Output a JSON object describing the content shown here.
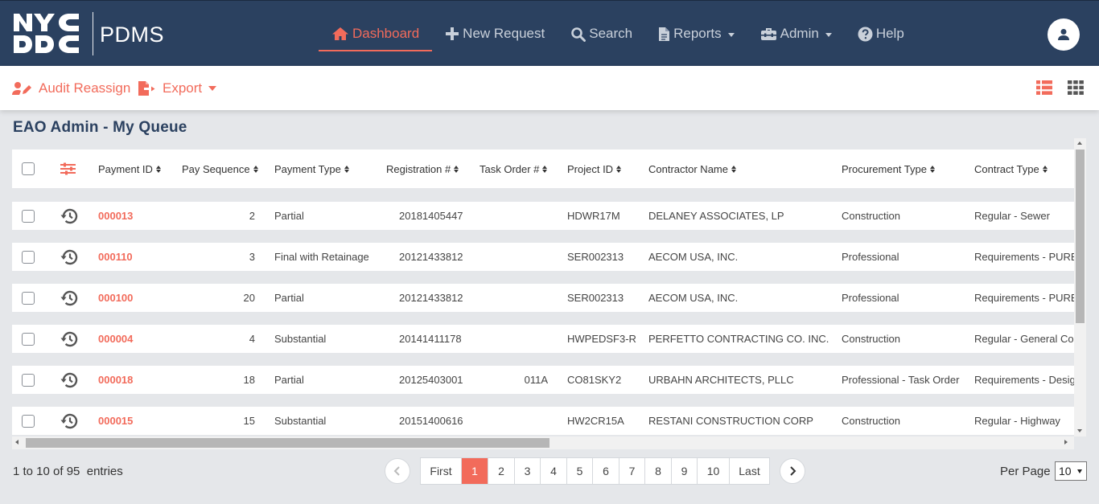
{
  "app": {
    "logo_text": "NYC DDC",
    "name": "PDMS"
  },
  "nav": [
    {
      "label": "Dashboard",
      "icon": "home-icon",
      "active": true
    },
    {
      "label": "New Request",
      "icon": "plus-icon"
    },
    {
      "label": "Search",
      "icon": "search-icon"
    },
    {
      "label": "Reports",
      "icon": "document-icon",
      "dropdown": true
    },
    {
      "label": "Admin",
      "icon": "toolbox-icon",
      "dropdown": true
    },
    {
      "label": "Help",
      "icon": "question-circle-icon"
    }
  ],
  "toolbar": {
    "audit_reassign": "Audit Reassign",
    "export": "Export"
  },
  "page_title": "EAO Admin - My Queue",
  "table": {
    "columns": [
      "Payment ID",
      "Pay Sequence",
      "Payment Type",
      "Registration #",
      "Task Order #",
      "Project ID",
      "Contractor Name",
      "Procurement Type",
      "Contract Type"
    ],
    "rows": [
      {
        "payment_id": "000013",
        "pay_sequence": "2",
        "payment_type": "Partial",
        "registration": "20181405447",
        "task_order": "",
        "project_id": "HDWR17M",
        "contractor": "DELANEY ASSOCIATES, LP",
        "procurement": "Construction",
        "contract_type": "Regular - Sewer"
      },
      {
        "payment_id": "000110",
        "pay_sequence": "3",
        "payment_type": "Final with Retainage",
        "registration": "20121433812",
        "task_order": "",
        "project_id": "SER002313",
        "contractor": "AECOM USA, INC.",
        "procurement": "Professional",
        "contract_type": "Requirements - PURE"
      },
      {
        "payment_id": "000100",
        "pay_sequence": "20",
        "payment_type": "Partial",
        "registration": "20121433812",
        "task_order": "",
        "project_id": "SER002313",
        "contractor": "AECOM USA, INC.",
        "procurement": "Professional",
        "contract_type": "Requirements - PURE"
      },
      {
        "payment_id": "000004",
        "pay_sequence": "4",
        "payment_type": "Substantial",
        "registration": "20141411178",
        "task_order": "",
        "project_id": "HWPEDSF3-R",
        "contractor": "PERFETTO CONTRACTING CO. INC.",
        "procurement": "Construction",
        "contract_type": "Regular - General Con"
      },
      {
        "payment_id": "000018",
        "pay_sequence": "18",
        "payment_type": "Partial",
        "registration": "20125403001",
        "task_order": "011A",
        "project_id": "CO81SKY2",
        "contractor": "URBAHN ARCHITECTS, PLLC",
        "procurement": "Professional - Task Order",
        "contract_type": "Requirements - Design"
      },
      {
        "payment_id": "000015",
        "pay_sequence": "15",
        "payment_type": "Substantial",
        "registration": "20151400616",
        "task_order": "",
        "project_id": "HW2CR15A",
        "contractor": "RESTANI CONSTRUCTION CORP",
        "procurement": "Construction",
        "contract_type": "Regular - Highway"
      }
    ]
  },
  "footer": {
    "entries_text": "1 to 10 of 95  entries",
    "pages": [
      "First",
      "1",
      "2",
      "3",
      "4",
      "5",
      "6",
      "7",
      "8",
      "9",
      "10",
      "Last"
    ],
    "current_page": "1",
    "per_page_label": "Per Page",
    "per_page_value": "10"
  },
  "colors": {
    "nav_bg": "#2b4160",
    "accent": "#f26b5b",
    "page_bg": "#e5e7ea"
  }
}
